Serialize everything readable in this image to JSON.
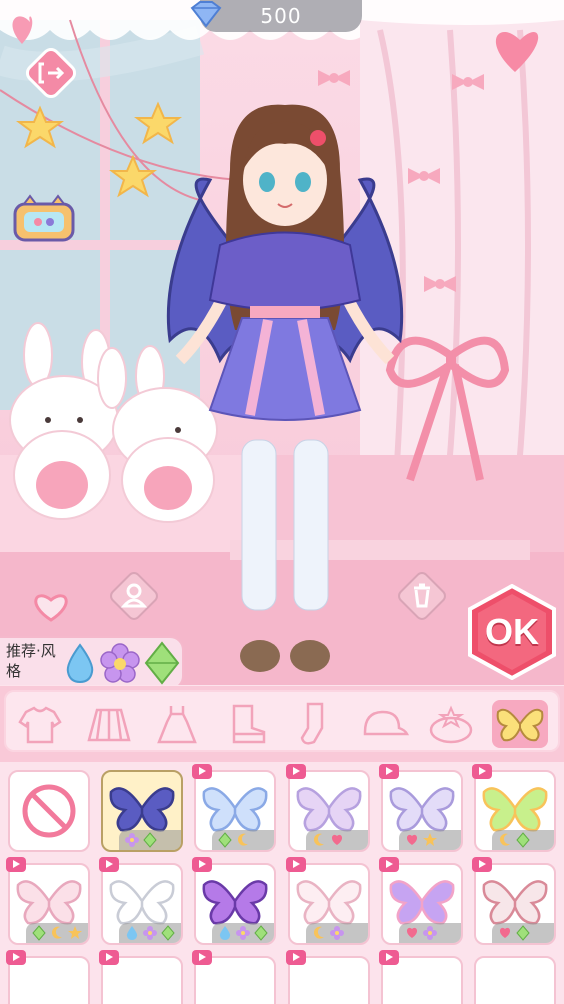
{
  "hud": {
    "gems": "500",
    "gem_icon": "diamond-icon",
    "exit_icon": "exit-icon",
    "gamepad_icon": "gamepad-icon"
  },
  "actions": {
    "ok_label": "OK",
    "profile_icon": "person-icon",
    "trash_icon": "trash-icon",
    "heart_icon": "heart-icon"
  },
  "style_recommend": {
    "label": "推荐·风格",
    "icons": [
      "water-drop-icon",
      "flower-icon",
      "green-gem-icon"
    ]
  },
  "categories": [
    {
      "icon": "top-icon",
      "active": false
    },
    {
      "icon": "skirt-icon",
      "active": false
    },
    {
      "icon": "dress-icon",
      "active": false
    },
    {
      "icon": "boots-icon",
      "active": false
    },
    {
      "icon": "socks-icon",
      "active": false
    },
    {
      "icon": "hat-icon",
      "active": false
    },
    {
      "icon": "accessory-icon",
      "active": false
    },
    {
      "icon": "wings-icon",
      "active": true
    }
  ],
  "items": [
    {
      "type": "none",
      "icon": "none-icon"
    },
    {
      "type": "dark-bat-wings",
      "selected": true,
      "stats": [
        "flower",
        "gem"
      ]
    },
    {
      "type": "blue-fairy-wings",
      "video": true,
      "stats": [
        "gem",
        "moon"
      ]
    },
    {
      "type": "pastel-butterfly-wings",
      "video": true,
      "stats": [
        "moon",
        "heart"
      ]
    },
    {
      "type": "lilac-fairy-wings",
      "video": true,
      "stats": [
        "heart",
        "star"
      ]
    },
    {
      "type": "green-leaf-wings",
      "video": true,
      "stats": [
        "moon",
        "gem"
      ]
    },
    {
      "type": "pink-feather-wings",
      "video": true,
      "stats": [
        "gem",
        "moon",
        "star"
      ]
    },
    {
      "type": "white-angel-wings",
      "video": true,
      "stats": [
        "drop",
        "flower",
        "gem"
      ]
    },
    {
      "type": "purple-butterfly-wings",
      "video": true,
      "stats": [
        "drop",
        "flower",
        "gem"
      ]
    },
    {
      "type": "pink-angel-wings",
      "video": true,
      "stats": [
        "moon",
        "flower"
      ]
    },
    {
      "type": "violet-butterfly-wings",
      "video": true,
      "stats": [
        "heart",
        "flower"
      ]
    },
    {
      "type": "rose-jeweled-wings",
      "video": true,
      "stats": [
        "heart",
        "gem"
      ]
    }
  ],
  "colors": {
    "accent_pink": "#f27a9c",
    "panel_pink": "#f9c9d8",
    "ok_red": "#ee4f6a",
    "selected_bg": "#fff1c8"
  }
}
